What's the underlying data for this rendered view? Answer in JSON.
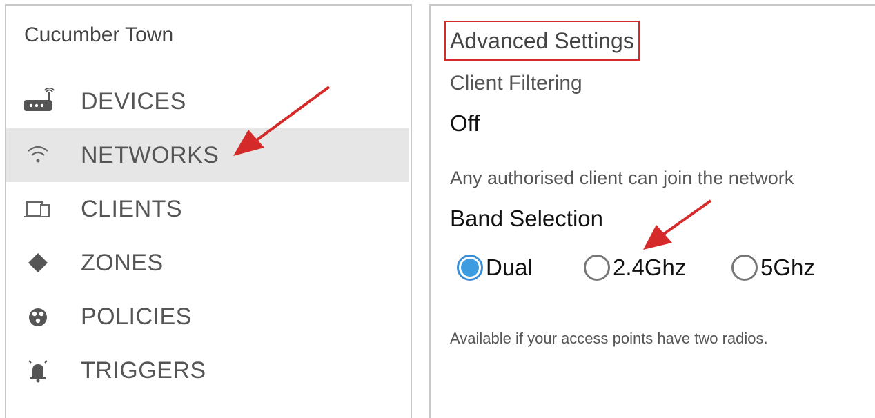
{
  "sidebar": {
    "site_name": "Cucumber Town",
    "items": [
      {
        "label": "DEVICES",
        "icon": "router-icon",
        "selected": false
      },
      {
        "label": "NETWORKS",
        "icon": "wifi-icon",
        "selected": true
      },
      {
        "label": "CLIENTS",
        "icon": "devices-icon",
        "selected": false
      },
      {
        "label": "ZONES",
        "icon": "diamond-icon",
        "selected": false
      },
      {
        "label": "POLICIES",
        "icon": "policy-icon",
        "selected": false
      },
      {
        "label": "TRIGGERS",
        "icon": "alarm-bell-icon",
        "selected": false
      }
    ]
  },
  "settings": {
    "title": "Advanced Settings",
    "client_filtering_label": "Client Filtering",
    "client_filtering_value": "Off",
    "client_filtering_desc": "Any authorised client can join the network",
    "band_selection_label": "Band Selection",
    "band_options": [
      {
        "label": "Dual",
        "checked": true
      },
      {
        "label": "2.4Ghz",
        "checked": false
      },
      {
        "label": "5Ghz",
        "checked": false
      }
    ],
    "band_help": "Available if your access points have two radios."
  },
  "colors": {
    "selected_bg": "#e6e6e6",
    "accent_blue": "#3d9be0",
    "annotation_red": "#d42a2a"
  }
}
